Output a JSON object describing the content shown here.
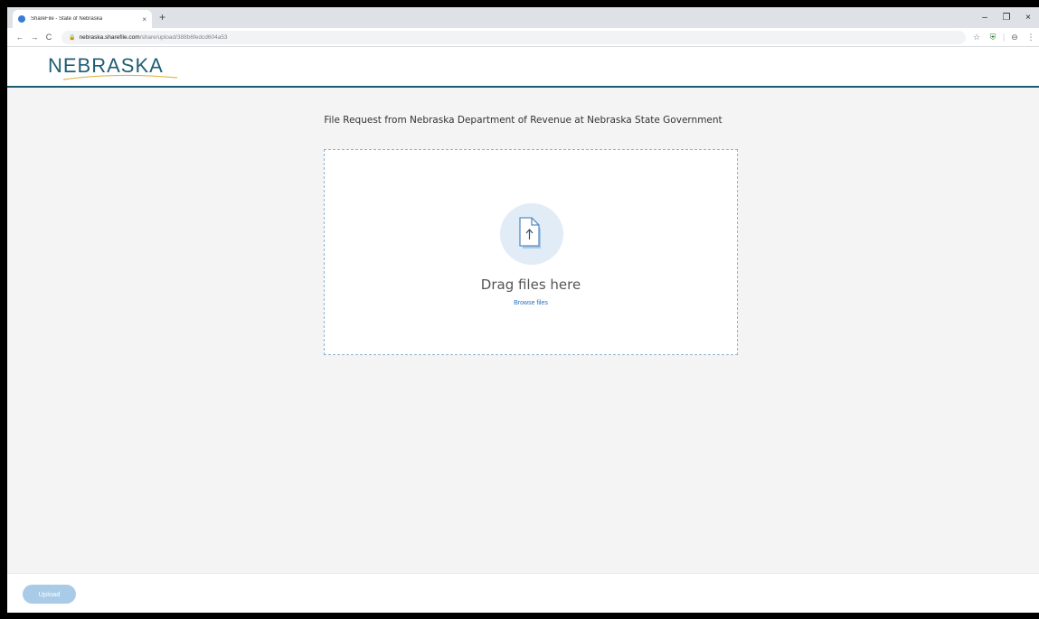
{
  "browser": {
    "tab_title": "ShareFile - State of Nebraska",
    "tab_close": "×",
    "new_tab": "+",
    "url_host": "nebraska.sharefile.com",
    "url_path": "/share/upload/388b6fedcd604a53",
    "window_controls": {
      "minimize": "–",
      "restore": "❐",
      "close": "×"
    }
  },
  "header": {
    "logo_text": "NEBRASKA"
  },
  "content": {
    "request_title": "File Request from Nebraska Department of Revenue at Nebraska State Government",
    "drag_text": "Drag files here",
    "browse_text": "Browse files"
  },
  "footer": {
    "upload_label": "Upload"
  },
  "colors": {
    "accent": "#1f5f73",
    "link": "#2a6ebb",
    "upload_button": "#a9cbe8",
    "content_bg": "#f4f4f5"
  }
}
